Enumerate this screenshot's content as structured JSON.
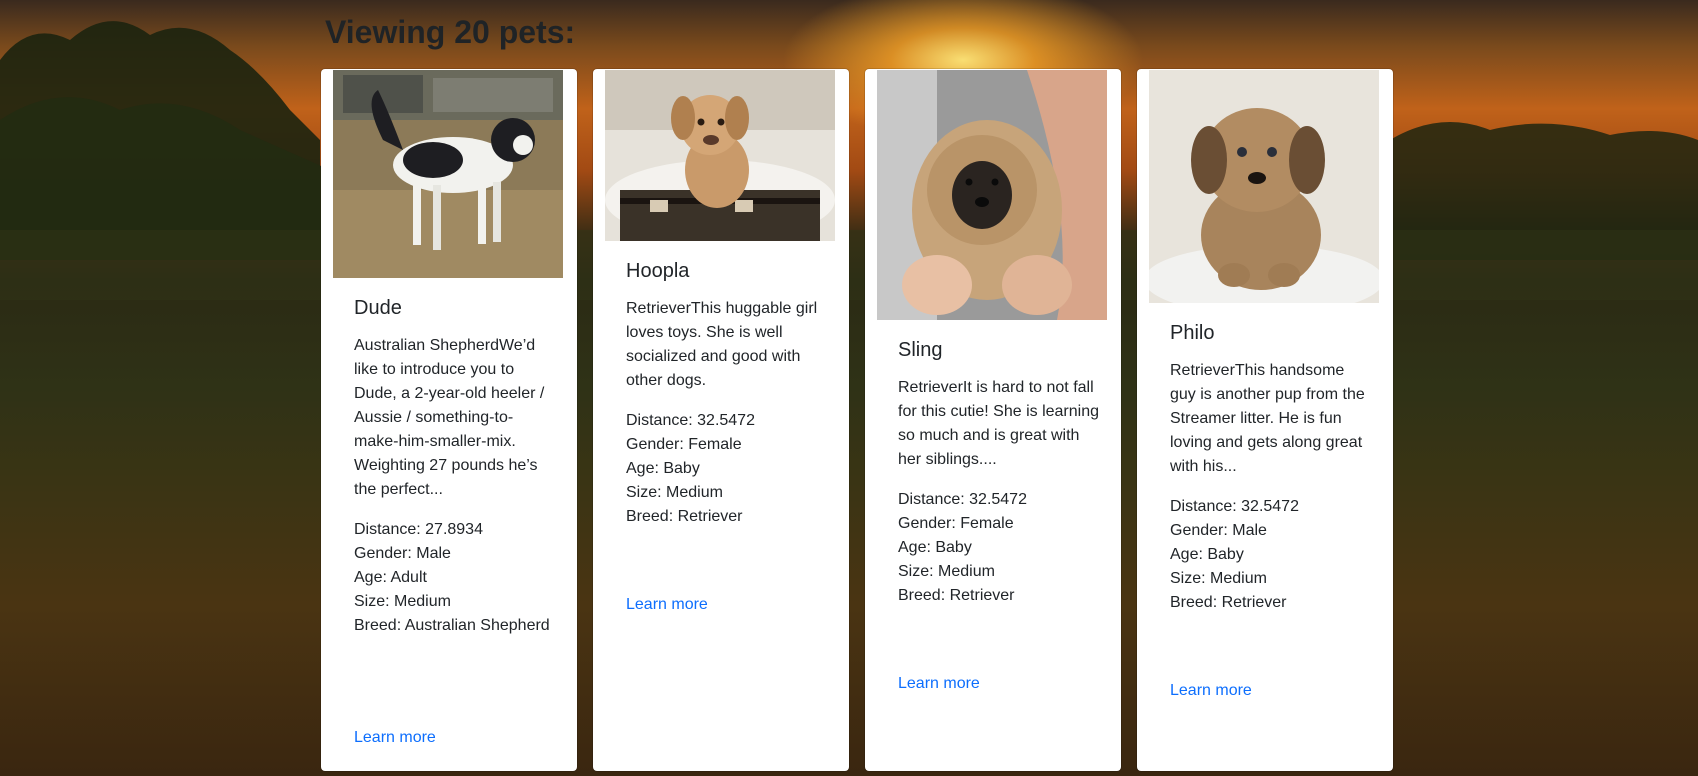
{
  "page": {
    "title": "Viewing 20 pets:"
  },
  "pets": [
    {
      "name": "Dude",
      "description": "Australian ShepherdWe’d like to introduce you to Dude, a 2-year-old heeler / Aussie / something-to-make-him-smaller-mix. Weighting 27 pounds he’s the perfect...",
      "distance": "Distance: 27.8934",
      "gender": "Gender: Male",
      "age": "Age: Adult",
      "size": "Size: Medium",
      "breed": "Breed: Australian Shepherd",
      "link": "Learn more",
      "photo_icon": "dog-photo-icon"
    },
    {
      "name": "Hoopla",
      "description": "RetrieverThis huggable girl loves toys. She is well socialized and good with other dogs.",
      "distance": "Distance: 32.5472",
      "gender": "Gender: Female",
      "age": "Age: Baby",
      "size": "Size: Medium",
      "breed": "Breed: Retriever",
      "link": "Learn more",
      "photo_icon": "puppy-photo-icon"
    },
    {
      "name": "Sling",
      "description": "RetrieverIt is hard to not fall for this cutie! She is learning so much and is great with her siblings....",
      "distance": "Distance: 32.5472",
      "gender": "Gender: Female",
      "age": "Age: Baby",
      "size": "Size: Medium",
      "breed": "Breed: Retriever",
      "link": "Learn more",
      "photo_icon": "puppy-photo-icon"
    },
    {
      "name": "Philo",
      "description": "RetrieverThis handsome guy is another pup from the Streamer litter. He is fun loving and gets along great with his...",
      "distance": "Distance: 32.5472",
      "gender": "Gender: Male",
      "age": "Age: Baby",
      "size": "Size: Medium",
      "breed": "Breed: Retriever",
      "link": "Learn more",
      "photo_icon": "puppy-photo-icon"
    }
  ],
  "colors": {
    "link": "#0d6efd",
    "card": "#ffffff",
    "text": "#212529"
  }
}
